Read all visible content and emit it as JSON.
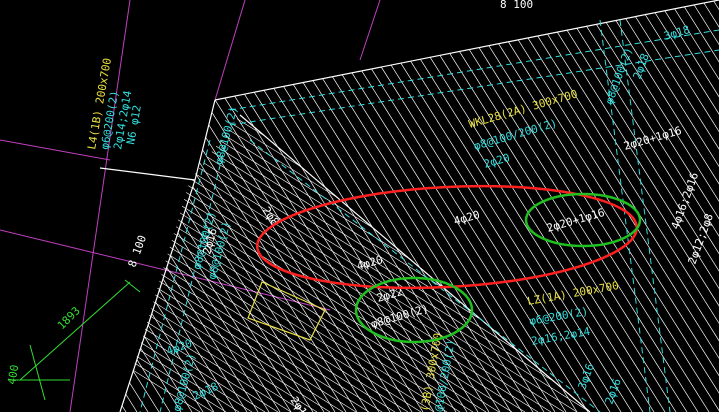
{
  "colors": {
    "background": "#000000",
    "slab_lines": "#ffffff",
    "rebar_cyan": "#33dddd",
    "beam_yellow": "#e8e040",
    "grid_magenta": "#c040c0",
    "dim_green": "#33dd33",
    "highlight_red": "#ff2020",
    "highlight_green": "#20c020"
  },
  "labels": {
    "top_dim": "8 100",
    "left_dim_8100": "8 100",
    "dim_1893": "1893",
    "dim_400": "400",
    "beam_L4_title": "L4(1B) 200x700",
    "beam_L4_stirrup": "φ6@200(2)",
    "beam_L4_bars": "2φ14;2φ14",
    "beam_L4_side": "N6 φ12",
    "wkl_title": "WKL28(2A) 300x700",
    "wkl_stirrup": "φ8@100/200(2)",
    "wkl_bars": "2φ20",
    "lz_title": "LZ(1A) 200x700",
    "lz_stirrup": "φ6@200(2)",
    "lz_bars": "2φ16;2φ14",
    "bottom_beam_title": "(3B) 300x700",
    "bottom_beam_stirrup": "@100/200(2)",
    "r_3phi18": "3φ18",
    "r_8phi10": "φ8@100(2)",
    "r_2phi18": "2φ18",
    "r_2phi20_2phi16": "2φ20+1φ16",
    "r_4phi16": "4φ16;2φ16",
    "r_2phi12": "2φ12;2φ8",
    "r_phi8_100_top": "φ8@100(2)",
    "r_phi8_100_left": "φ8@100(2)",
    "r_phi8_100_left2": "φ8@100(2)",
    "r_2phi8_left": "2φ8",
    "r_2phi16_left": "2φ16",
    "r_4phi20_mid": "4φ20",
    "r_4phi20_left": "4φ20",
    "r_4phi20_bottom": "4φ20",
    "r_2phi20_1phi16_circle": "2φ20+1φ16",
    "r_2phi22_circle": "2φ22",
    "r_phi8_100_circle": "φ8@100(2)",
    "r_2phi20_plus16_top": "2φ20+1φ16",
    "r_3phi16_bottom": "3φ16",
    "r_2phi16_bottom": "2φ16",
    "r_2phi18_bottom": "2φ18",
    "r_phi8_100_bottom": "φ8@100(2)",
    "r_2phi_bottom_right": "2φ18"
  }
}
